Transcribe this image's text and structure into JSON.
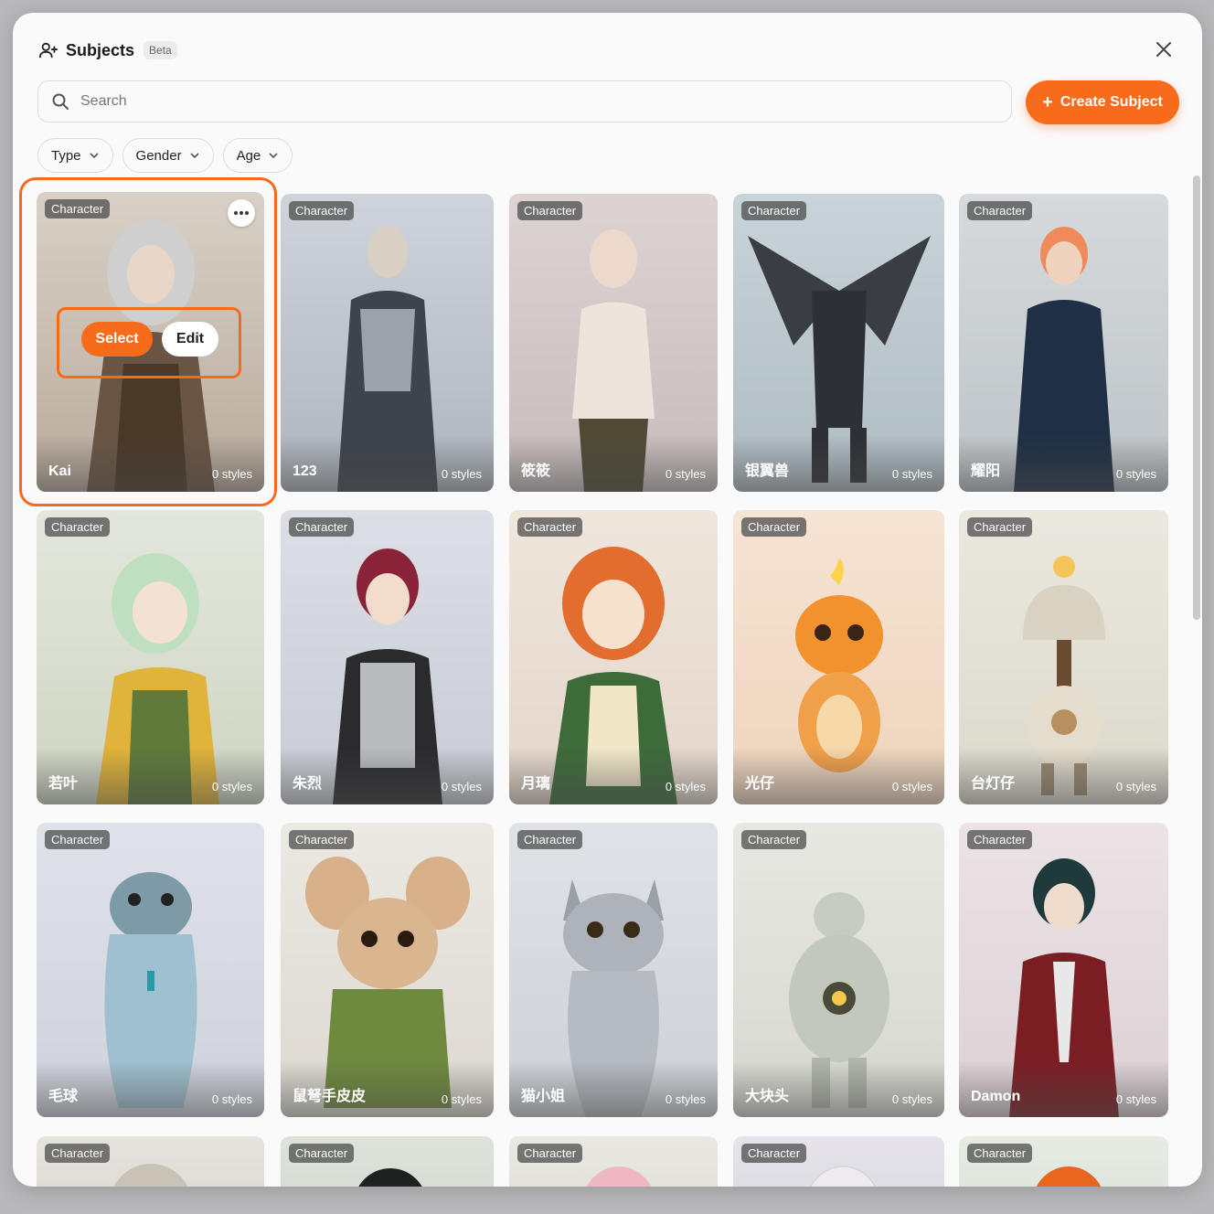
{
  "header": {
    "title": "Subjects",
    "badge": "Beta"
  },
  "search": {
    "placeholder": "Search"
  },
  "create_label": "Create Subject",
  "filters": [
    "Type",
    "Gender",
    "Age"
  ],
  "actions": {
    "select_label": "Select",
    "edit_label": "Edit"
  },
  "accent": "#f86b1a",
  "cards": [
    {
      "type": "Character",
      "name": "Kai",
      "styles": "0 styles"
    },
    {
      "type": "Character",
      "name": "123",
      "styles": "0 styles"
    },
    {
      "type": "Character",
      "name": "筱筱",
      "styles": "0 styles"
    },
    {
      "type": "Character",
      "name": "银翼兽",
      "styles": "0 styles"
    },
    {
      "type": "Character",
      "name": "耀阳",
      "styles": "0 styles"
    },
    {
      "type": "Character",
      "name": "若叶",
      "styles": "0 styles"
    },
    {
      "type": "Character",
      "name": "朱烈",
      "styles": "0 styles"
    },
    {
      "type": "Character",
      "name": "月璃",
      "styles": "0 styles"
    },
    {
      "type": "Character",
      "name": "光仔",
      "styles": "0 styles"
    },
    {
      "type": "Character",
      "name": "台灯仔",
      "styles": "0 styles"
    },
    {
      "type": "Character",
      "name": "毛球",
      "styles": "0 styles"
    },
    {
      "type": "Character",
      "name": "鼠弩手皮皮",
      "styles": "0 styles"
    },
    {
      "type": "Character",
      "name": "猫小姐",
      "styles": "0 styles"
    },
    {
      "type": "Character",
      "name": "大块头",
      "styles": "0 styles"
    },
    {
      "type": "Character",
      "name": "Damon",
      "styles": "0 styles"
    },
    {
      "type": "Character",
      "name": "",
      "styles": ""
    },
    {
      "type": "Character",
      "name": "",
      "styles": ""
    },
    {
      "type": "Character",
      "name": "",
      "styles": ""
    },
    {
      "type": "Character",
      "name": "",
      "styles": ""
    },
    {
      "type": "Character",
      "name": "",
      "styles": ""
    }
  ]
}
